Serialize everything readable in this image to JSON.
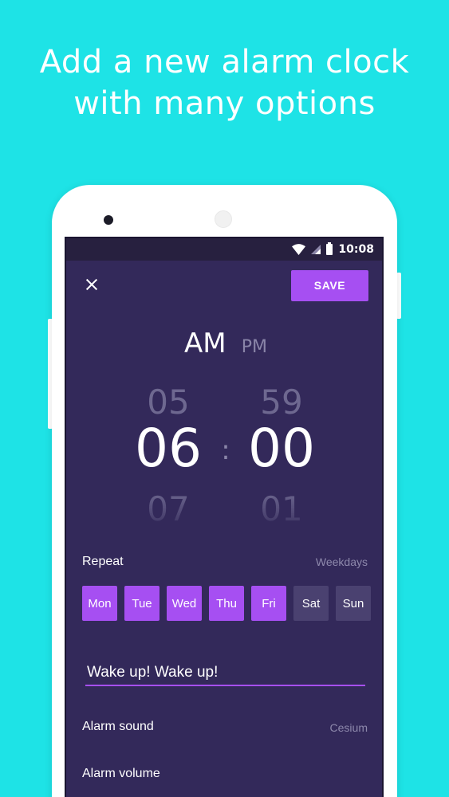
{
  "promo": {
    "line1": "Add a new alarm clock",
    "line2": "with many options"
  },
  "status_bar": {
    "time": "10:08",
    "icons": [
      "wifi-icon",
      "signal-icon",
      "battery-icon"
    ]
  },
  "toolbar": {
    "close_icon": "close-icon",
    "save_label": "SAVE"
  },
  "time_picker": {
    "am_label": "AM",
    "pm_label": "PM",
    "selected_period": "AM",
    "hour_prev": "05",
    "hour": "06",
    "hour_next": "07",
    "separator": ":",
    "minute_prev": "59",
    "minute": "00",
    "minute_next": "01"
  },
  "repeat": {
    "label": "Repeat",
    "summary": "Weekdays",
    "days": [
      {
        "label": "Mon",
        "selected": true
      },
      {
        "label": "Tue",
        "selected": true
      },
      {
        "label": "Wed",
        "selected": true
      },
      {
        "label": "Thu",
        "selected": true
      },
      {
        "label": "Fri",
        "selected": true
      },
      {
        "label": "Sat",
        "selected": false
      },
      {
        "label": "Sun",
        "selected": false
      }
    ]
  },
  "alarm_label": {
    "value": "Wake up! Wake up!"
  },
  "settings": {
    "sound_label": "Alarm sound",
    "sound_value": "Cesium",
    "volume_label": "Alarm volume"
  },
  "colors": {
    "background": "#1ee3e6",
    "screen": "#33295a",
    "accent": "#a64ff2",
    "day_off": "#4a4170"
  }
}
